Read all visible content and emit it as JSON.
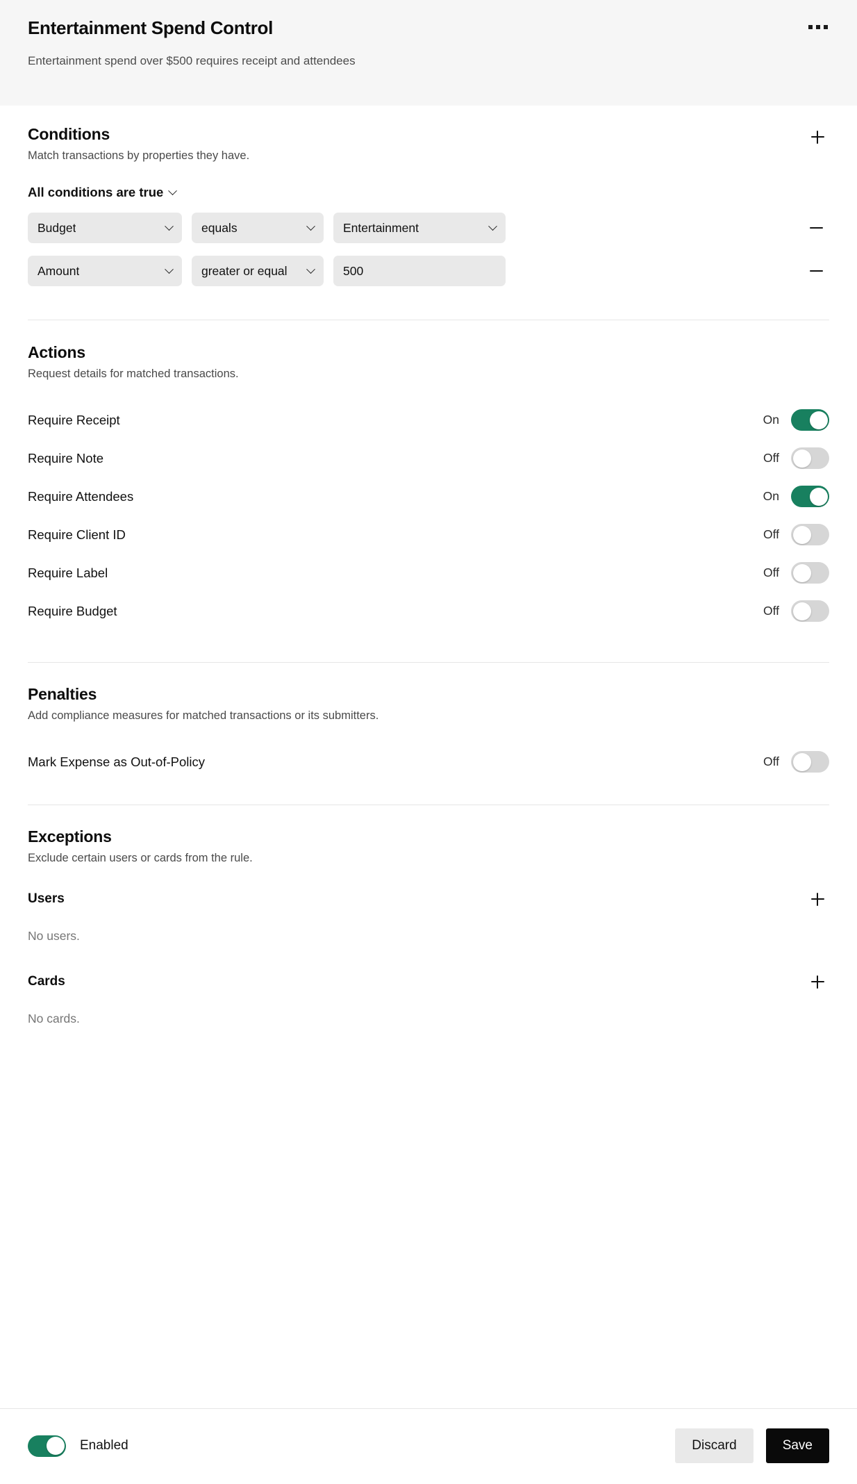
{
  "header": {
    "title": "Entertainment Spend Control",
    "subtitle": "Entertainment spend over $500 requires receipt and attendees",
    "menu_icon": "kebab-menu-icon"
  },
  "conditions": {
    "title": "Conditions",
    "subtitle": "Match transactions by properties they have.",
    "add_icon": "plus-icon",
    "match_mode": "All conditions are true",
    "remove_icon": "minus-icon",
    "rows": [
      {
        "field": "Budget",
        "operator": "equals",
        "value": "Entertainment",
        "value_type": "select"
      },
      {
        "field": "Amount",
        "operator": "greater or equal",
        "value": "500",
        "value_type": "text"
      }
    ]
  },
  "actions": {
    "title": "Actions",
    "subtitle": "Request details for matched transactions.",
    "items": [
      {
        "label": "Require Receipt",
        "state": "On",
        "on": true
      },
      {
        "label": "Require Note",
        "state": "Off",
        "on": false
      },
      {
        "label": "Require Attendees",
        "state": "On",
        "on": true
      },
      {
        "label": "Require Client ID",
        "state": "Off",
        "on": false
      },
      {
        "label": "Require Label",
        "state": "Off",
        "on": false
      },
      {
        "label": "Require Budget",
        "state": "Off",
        "on": false
      }
    ]
  },
  "penalties": {
    "title": "Penalties",
    "subtitle": "Add compliance measures for matched transactions or its submitters.",
    "items": [
      {
        "label": "Mark Expense as Out-of-Policy",
        "state": "Off",
        "on": false
      }
    ]
  },
  "exceptions": {
    "title": "Exceptions",
    "subtitle": "Exclude certain users or cards from the rule.",
    "users": {
      "title": "Users",
      "empty": "No users.",
      "add_icon": "plus-icon"
    },
    "cards": {
      "title": "Cards",
      "empty": "No cards.",
      "add_icon": "plus-icon"
    }
  },
  "footer": {
    "enabled_label": "Enabled",
    "enabled_on": true,
    "discard_label": "Discard",
    "save_label": "Save"
  },
  "colors": {
    "accent_green": "#18805f",
    "header_bg": "#f6f6f6",
    "field_bg": "#e9e9e9",
    "primary_btn_bg": "#0a0a0a",
    "divider": "#e6e6e6"
  }
}
